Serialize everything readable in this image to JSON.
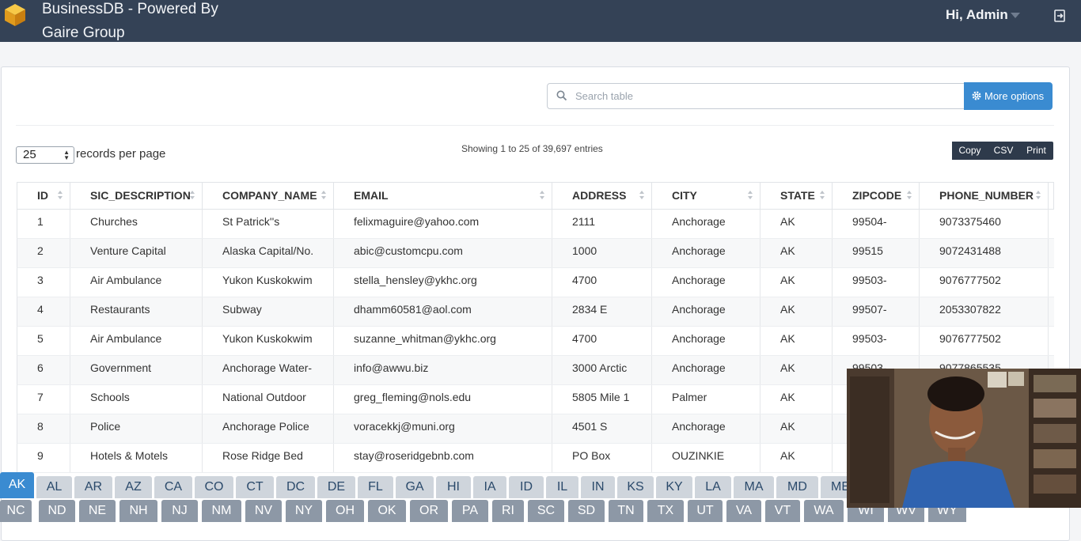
{
  "header": {
    "title": "BusinessDB - Powered By Gaire Group",
    "greeting": "Hi, Admin",
    "logo_icon": "cube-logo-icon",
    "logout_icon": "logout-icon"
  },
  "toolbar": {
    "search_placeholder": "Search table",
    "more_options": "More options",
    "page_length": "25",
    "records_label": "records per page",
    "info": "Showing 1 to 25 of 39,697 entries",
    "export_buttons": [
      "Copy",
      "CSV",
      "Print"
    ]
  },
  "table": {
    "columns": [
      "ID",
      "SIC_DESCRIPTION",
      "COMPANY_NAME",
      "EMAIL",
      "ADDRESS",
      "CITY",
      "STATE",
      "ZIPCODE",
      "PHONE_NUMBER"
    ],
    "rows": [
      [
        "1",
        "Churches",
        "St Patrick''s",
        "felixmaguire@yahoo.com",
        "2111",
        "Anchorage",
        "AK",
        "99504-",
        "9073375460"
      ],
      [
        "2",
        "Venture Capital",
        "Alaska Capital/No.",
        "abic@customcpu.com",
        "1000",
        "Anchorage",
        "AK",
        "99515",
        "9072431488"
      ],
      [
        "3",
        "Air Ambulance",
        "Yukon Kuskokwim",
        "stella_hensley@ykhc.org",
        "4700",
        "Anchorage",
        "AK",
        "99503-",
        "9076777502"
      ],
      [
        "4",
        "Restaurants",
        "Subway",
        "dhamm60581@aol.com",
        "2834 E",
        "Anchorage",
        "AK",
        "99507-",
        "2053307822"
      ],
      [
        "5",
        "Air Ambulance",
        "Yukon Kuskokwim",
        "suzanne_whitman@ykhc.org",
        "4700",
        "Anchorage",
        "AK",
        "99503-",
        "9076777502"
      ],
      [
        "6",
        "Government",
        "Anchorage Water-",
        "info@awwu.biz",
        "3000 Arctic",
        "Anchorage",
        "AK",
        "99503-",
        "9077865535"
      ],
      [
        "7",
        "Schools",
        "National Outdoor",
        "greg_fleming@nols.edu",
        "5805 Mile 1",
        "Palmer",
        "AK",
        "",
        ""
      ],
      [
        "8",
        "Police",
        "Anchorage Police",
        "voracekkj@muni.org",
        "4501 S",
        "Anchorage",
        "AK",
        "",
        ""
      ],
      [
        "9",
        "Hotels & Motels",
        "Rose Ridge Bed",
        "stay@roseridgebnb.com",
        "PO Box",
        "OUZINKIE",
        "AK",
        "",
        ""
      ]
    ]
  },
  "state_tabs": {
    "row1": [
      "AK",
      "AL",
      "AR",
      "AZ",
      "CA",
      "CO",
      "CT",
      "DC",
      "DE",
      "FL",
      "GA",
      "HI",
      "IA",
      "ID",
      "IL",
      "IN",
      "KS",
      "KY",
      "LA",
      "MA",
      "MD",
      "ME"
    ],
    "row2": [
      "NC",
      "ND",
      "NE",
      "NH",
      "NJ",
      "NM",
      "NV",
      "NY",
      "OH",
      "OK",
      "OR",
      "PA",
      "RI",
      "SC",
      "SD",
      "TN",
      "TX",
      "UT",
      "VA",
      "VT",
      "WA",
      "WI",
      "WV",
      "WY"
    ],
    "active": "AK"
  },
  "colors": {
    "topbar": "#344256",
    "accent": "#3a8bd1",
    "export_bg": "#2e3a4b"
  }
}
